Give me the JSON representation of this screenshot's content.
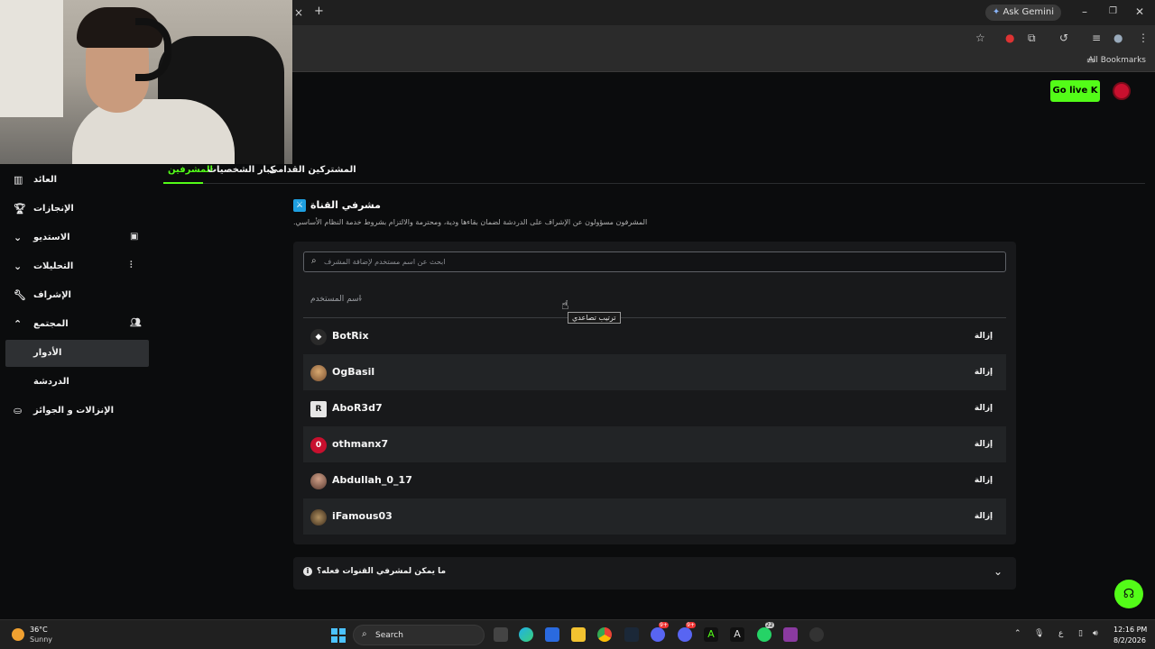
{
  "browser": {
    "ask_gemini": "Ask Gemini",
    "all_bookmarks": "All Bookmarks",
    "new_tab": "+",
    "close_tab": "×"
  },
  "header": {
    "go_live": "Go live",
    "go_live_logo": "K"
  },
  "sidebar": {
    "items": [
      {
        "label": "العائد",
        "icon": "chart-icon"
      },
      {
        "label": "الإنجازات",
        "icon": "trophy-icon"
      },
      {
        "label": "الاستديو",
        "icon": "studio-icon"
      },
      {
        "label": "التحليلات",
        "icon": "analytics-icon"
      },
      {
        "label": "الإشراف",
        "icon": "wrench-icon"
      },
      {
        "label": "المجتمع",
        "icon": "community-icon"
      },
      {
        "label": "الأدوار",
        "icon": ""
      },
      {
        "label": "الدردشة",
        "icon": ""
      },
      {
        "label": "الإنزالات و الجوائز",
        "icon": "gift-icon"
      }
    ]
  },
  "tabs": [
    {
      "label": "المشرفين"
    },
    {
      "label": "كبار الشخصيات"
    },
    {
      "label": "المشتركين القدامى"
    }
  ],
  "section": {
    "title": "مشرفي القناة",
    "description": ".المشرفون مسؤولون عن الإشراف على الدردشة لضمان بقاءها ودية، ومحترمة والالتزام بشروط خدمة النظام الأساسي"
  },
  "search": {
    "placeholder": "ابحث عن اسم مستخدم لإضافة المشرف",
    "value": ""
  },
  "table": {
    "column_header": "اسم المستخدم",
    "tooltip": "ترتيب تصاعدي",
    "remove_label": "إزالة",
    "rows": [
      {
        "username": "BotRix",
        "avatar_color": "#2a2a2a",
        "avatar_text": "◆"
      },
      {
        "username": "OgBasil",
        "avatar_color": "#a87a4c",
        "avatar_text": ""
      },
      {
        "username": "AboR3d7",
        "avatar_color": "#e6e6e6",
        "avatar_text": "R"
      },
      {
        "username": "othmanx7",
        "avatar_color": "#c8102e",
        "avatar_text": "0"
      },
      {
        "username": "Abdullah_0_17",
        "avatar_color": "#8a5a4a",
        "avatar_text": ""
      },
      {
        "username": "iFamous03",
        "avatar_color": "#6a5a3a",
        "avatar_text": ""
      }
    ]
  },
  "faq": {
    "label": "ما يمكن لمشرفي القنوات فعله؟"
  },
  "taskbar": {
    "weather_temp": "36°C",
    "weather_condition": "Sunny",
    "search_label": "Search",
    "time": "12:16 PM",
    "date": "8/2/2026",
    "language": "ع",
    "badge_discord_1": "9+",
    "badge_discord_2": "9+",
    "badge_whatsapp": "22"
  },
  "colors": {
    "accent": "#53fc18",
    "background": "#0b0c0d",
    "card": "#18191b"
  }
}
